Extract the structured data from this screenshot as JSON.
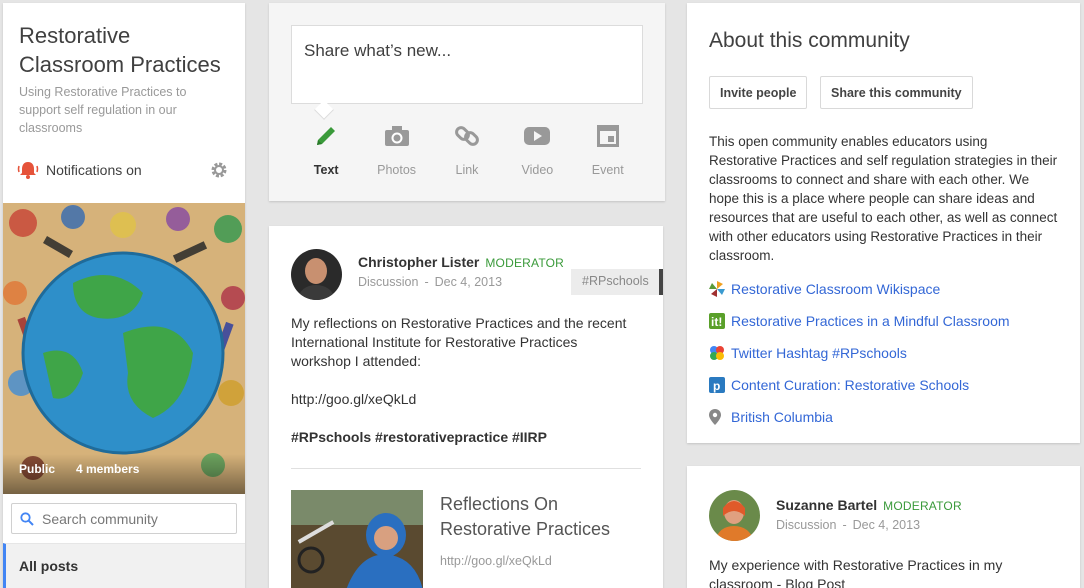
{
  "community": {
    "title": "Restorative Classroom Practices",
    "description": "Using Restorative Practices to support self regulation in our classrooms",
    "notifications_label": "Notifications on",
    "privacy": "Public",
    "members": "4 members",
    "search_placeholder": "Search community",
    "nav_all_posts": "All posts"
  },
  "share": {
    "placeholder": "Share what’s new...",
    "options": [
      {
        "label": "Text",
        "icon": "pencil-icon"
      },
      {
        "label": "Photos",
        "icon": "camera-icon"
      },
      {
        "label": "Link",
        "icon": "link-icon"
      },
      {
        "label": "Video",
        "icon": "video-icon"
      },
      {
        "label": "Event",
        "icon": "event-icon"
      }
    ]
  },
  "post1": {
    "author": "Christopher Lister",
    "role": "MODERATOR",
    "category": "Discussion",
    "date": "Dec 4, 2013",
    "hashtag": "#RPschools",
    "body_line1": "My reflections on Restorative Practices and the recent International Institute for Restorative Practices workshop I attended:",
    "body_link": "http://goo.gl/xeQkLd",
    "body_tags": "#RPschools #restorativepractice #IIRP",
    "link_title": "Reflections On Restorative Practices",
    "link_url": "http://goo.gl/xeQkLd"
  },
  "about": {
    "title": "About this community",
    "invite_label": "Invite people",
    "share_label": "Share this community",
    "description": "This open community enables educators using Restorative Practices and self regulation strategies in their classrooms to connect and share with each other. We hope this is a place where people can share ideas and resources that are useful to each other, as well as connect with other educators using Restorative Practices in their classroom.",
    "links": [
      {
        "label": "Restorative Classroom Wikispace",
        "icon": "pinwheel-icon"
      },
      {
        "label": "Restorative Practices in a Mindful Classroom",
        "icon": "it-icon"
      },
      {
        "label": "Twitter Hashtag #RPschools",
        "icon": "google-dots-icon"
      },
      {
        "label": "Content Curation: Restorative Schools",
        "icon": "p-icon"
      },
      {
        "label": "British Columbia",
        "icon": "location-pin-icon"
      }
    ]
  },
  "post2": {
    "author": "Suzanne Bartel",
    "role": "MODERATOR",
    "category": "Discussion",
    "date": "Dec 4, 2013",
    "body": "My experience with Restorative Practices in my classroom - Blog Post"
  },
  "colors": {
    "link": "#3367d6",
    "moderator": "#3a9a3a",
    "notification": "#e5533a",
    "active_nav": "#4285f4"
  }
}
